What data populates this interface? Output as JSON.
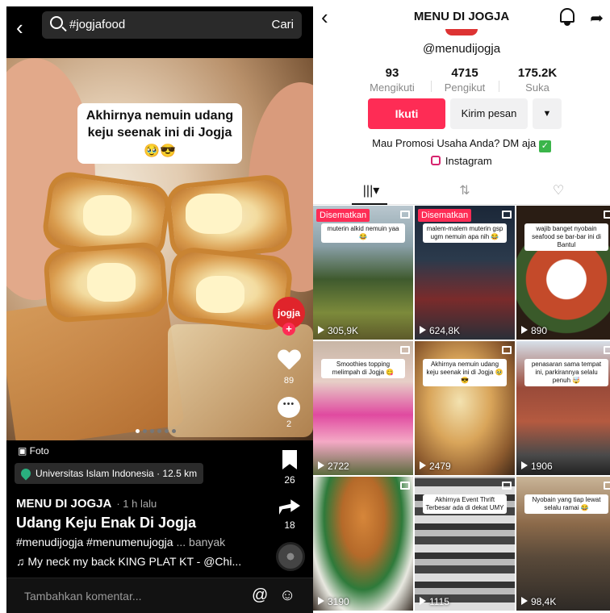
{
  "left": {
    "search": {
      "query": "#jogjafood",
      "button": "Cari"
    },
    "overlay_caption": "Akhirnya nemuin udang keju seenak ini di Jogja",
    "overlay_emoji": "🥹😎",
    "side": {
      "brand": "jogja",
      "likes": "89",
      "comments": "2",
      "bookmarks": "26",
      "shares": "18"
    },
    "post": {
      "type_label": "Foto",
      "location": "Universitas Islam Indonesia · 12.5 km",
      "author": "MENU DI JOGJA",
      "time": "· 1 h lalu",
      "title": "Udang Keju Enak Di Jogja",
      "hashtags": "#menudijogja #menumenujogja",
      "more": "... banyak",
      "music": "♫ My neck my back KING PLAT KT - @Chi..."
    },
    "comment_placeholder": "Tambahkan komentar...",
    "at_icon": "@",
    "emoji_icon": "☺"
  },
  "right": {
    "title": "MENU DI JOGJA",
    "handle": "@menudijogja",
    "stats": [
      {
        "value": "93",
        "label": "Mengikuti"
      },
      {
        "value": "4715",
        "label": "Pengikut"
      },
      {
        "value": "175.2K",
        "label": "Suka"
      }
    ],
    "buttons": {
      "follow": "Ikuti",
      "message": "Kirim pesan",
      "more": "▼"
    },
    "bio": "Mau Promosi Usaha Anda? DM aja",
    "instagram": "Instagram",
    "tabs": [
      "|||▾",
      "⇅",
      "♡"
    ],
    "grid": [
      {
        "pinned": "Disematkan",
        "caption": "muterin alkid nemuin yaa 😂",
        "views": "305,9K",
        "bg": "linear-gradient(180deg,#b9c7cf 0%,#8aa0a8 30%,#3f5a2e 55%,#7c8a3b 80%,#5d5a2a 100%)"
      },
      {
        "pinned": "Disematkan",
        "caption": "malem-malem muterin gsp ugm nemuin apa nih 😂",
        "views": "624,8K",
        "bg": "linear-gradient(180deg,#1b2738 0%,#2b3a4c 40%,#7a2b2b 70%,#2a2f38 100%)"
      },
      {
        "pinned": "",
        "caption": "wajib banget nyobain seafood se bar-bar ini di Bantul",
        "views": "890",
        "bg": "radial-gradient(circle at 50% 55%,#fff 0 22%,#c44a2a 23% 45%,#3a5a2a 46% 60%,#2a1d14 61%)"
      },
      {
        "pinned": "",
        "caption": "Smoothies topping melimpah di Jogja 😋",
        "views": "2722",
        "bg": "linear-gradient(180deg,#c8b6a6 0%,#e7cfc7 30%,#e04aa0 55%,#f4a9c5 75%,#5b6b3d 100%)"
      },
      {
        "pinned": "",
        "caption": "Akhirnya nemuin udang keju seenak ini di Jogja 🥹😎",
        "views": "2479",
        "bg": "radial-gradient(ellipse at 45% 45%,#f3e2b0 0%,#d9a55a 40%,#8c5a2e 75%,#3d2818 100%)"
      },
      {
        "pinned": "",
        "caption": "penasaran sama tempat ini, parkirannya selalu penuh 🤯",
        "views": "1906",
        "bg": "linear-gradient(180deg,#d7dfe8 0%,#9a4b3a 35%,#b45a40 60%,#4a4a4a 85%,#222 100%)"
      },
      {
        "pinned": "",
        "caption": "",
        "views": "3190",
        "bg": "radial-gradient(ellipse at 50% 30%,#d6863a 0%,#b56a2a 30%,#2e7a3a 55%,#e8e8e0 75%,#3a3028 100%)"
      },
      {
        "pinned": "",
        "caption": "Akhirnya Event Thrift Terbesar ada di dekat UMY",
        "views": "1115",
        "bg": "repeating-linear-gradient(0deg,#ddd 0 10px,#444 10px 20px,#bbb 20px 28px,#333 28px 36px)"
      },
      {
        "pinned": "",
        "caption": "Nyobain yang tiap lewat selalu ramai 😂",
        "views": "98,4K",
        "bg": "linear-gradient(180deg,#c9b497 0%,#8c6a4a 35%,#5a4a3a 60%,#2e2a26 100%)"
      }
    ]
  }
}
